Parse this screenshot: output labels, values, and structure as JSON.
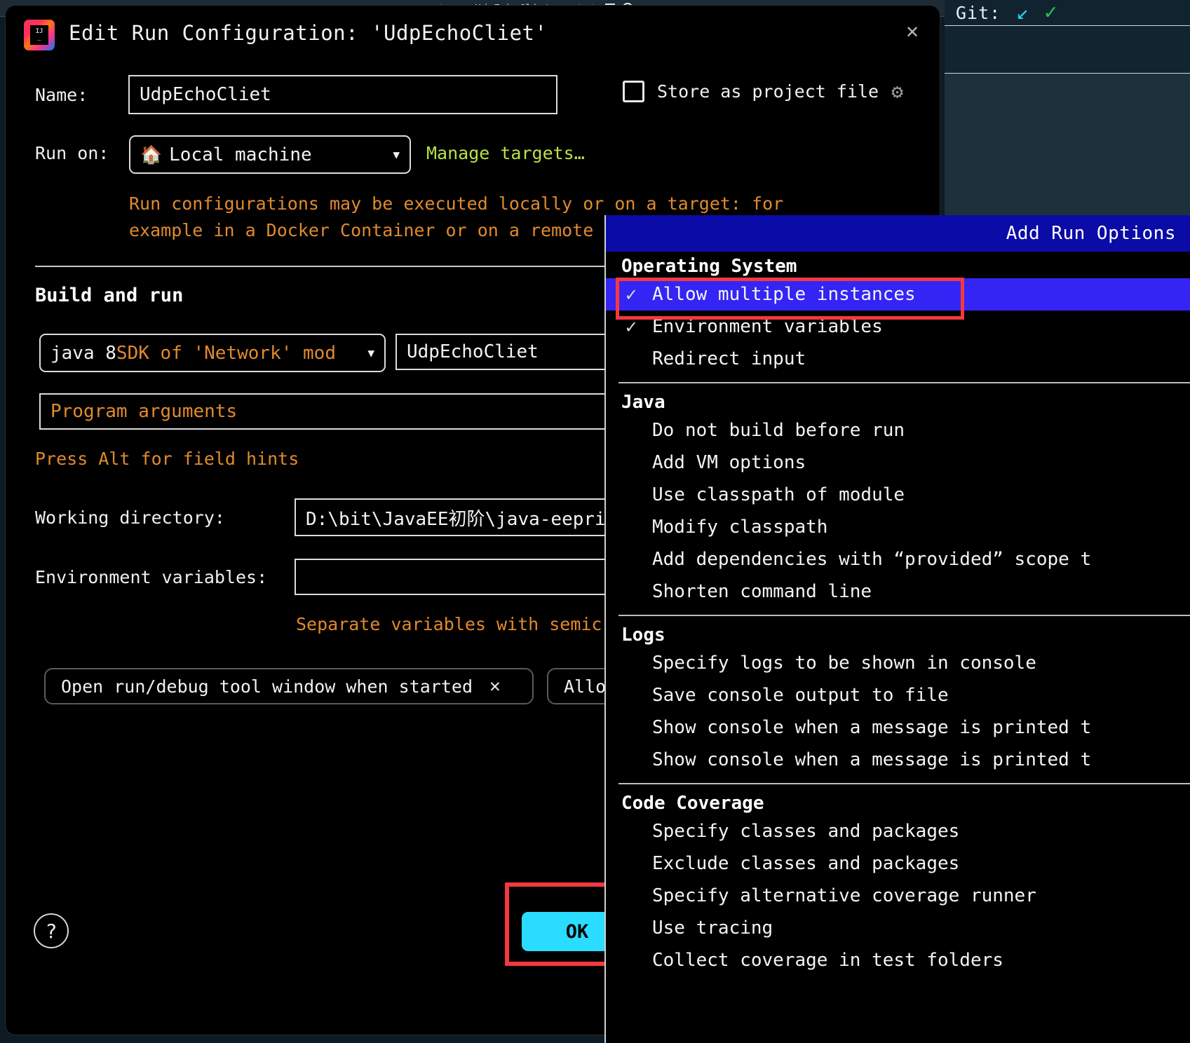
{
  "ide": {
    "tab_label": "UdpEchoCliet",
    "git_label": "Git:",
    "git_down_icon": "arrow-down-left-icon",
    "git_check_icon": "check-icon"
  },
  "dialog": {
    "title": "Edit Run Configuration: 'UdpEchoCliet'",
    "close_icon": "close-icon",
    "logo_icon": "intellij-idea-logo",
    "name_label": "Name:",
    "name_value": "UdpEchoCliet",
    "store_as_project_file_label": "Store as project file",
    "store_checked": false,
    "gear_icon": "gear-icon",
    "run_on_label": "Run on:",
    "run_on_value": "Local machine",
    "run_on_icon": "home-icon",
    "manage_targets_link": "Manage targets…",
    "description_line1": "Run configurations may be executed locally or on a target: for",
    "description_line2": "example in a Docker Container or on a remote",
    "section_build_and_run": "Build and run",
    "sdk_value_prefix": "java 8 ",
    "sdk_value_suffix": "SDK of 'Network' mod",
    "main_class_value": "UdpEchoCliet",
    "program_arguments_placeholder": "Program arguments",
    "alt_hint": "Press Alt for field hints",
    "working_directory_label": "Working directory:",
    "working_directory_value": "D:\\bit\\JavaEE初阶\\java-eeprin",
    "environment_variables_label": "Environment variables:",
    "environment_variables_value": "",
    "separate_variables_hint": "Separate variables with semic",
    "chips": [
      {
        "label": "Open run/debug tool window when started",
        "close_icon": "close-icon"
      },
      {
        "label": "Allo",
        "close_icon": "close-icon"
      }
    ],
    "help_label": "?",
    "ok_label": "OK",
    "accent_ok_color": "#2adcff",
    "highlight_color": "#f6383f"
  },
  "menu": {
    "header_title": "Add Run Options",
    "groups": [
      {
        "title": "Operating System",
        "items": [
          {
            "label": "Allow multiple instances",
            "checked": true,
            "selected": true
          },
          {
            "label": "Environment variables",
            "checked": true,
            "selected": false
          },
          {
            "label": "Redirect input",
            "checked": false,
            "selected": false
          }
        ]
      },
      {
        "title": "Java",
        "items": [
          {
            "label": "Do not build before run",
            "checked": false,
            "selected": false
          },
          {
            "label": "Add VM options",
            "checked": false,
            "selected": false
          },
          {
            "label": "Use classpath of module",
            "checked": false,
            "selected": false
          },
          {
            "label": "Modify classpath",
            "checked": false,
            "selected": false
          },
          {
            "label": "Add dependencies with “provided” scope t",
            "checked": false,
            "selected": false
          },
          {
            "label": "Shorten command line",
            "checked": false,
            "selected": false
          }
        ]
      },
      {
        "title": "Logs",
        "items": [
          {
            "label": "Specify logs to be shown in console",
            "checked": false,
            "selected": false
          },
          {
            "label": "Save console output to file",
            "checked": false,
            "selected": false
          },
          {
            "label": "Show console when a message is printed t",
            "checked": false,
            "selected": false
          },
          {
            "label": "Show console when a message is printed t",
            "checked": false,
            "selected": false
          }
        ]
      },
      {
        "title": "Code Coverage",
        "items": [
          {
            "label": "Specify classes and packages",
            "checked": false,
            "selected": false
          },
          {
            "label": "Exclude classes and packages",
            "checked": false,
            "selected": false
          },
          {
            "label": "Specify alternative coverage runner",
            "checked": false,
            "selected": false
          },
          {
            "label": "Use tracing",
            "checked": false,
            "selected": false
          },
          {
            "label": "Collect coverage in test folders",
            "checked": false,
            "selected": false
          }
        ]
      }
    ]
  }
}
